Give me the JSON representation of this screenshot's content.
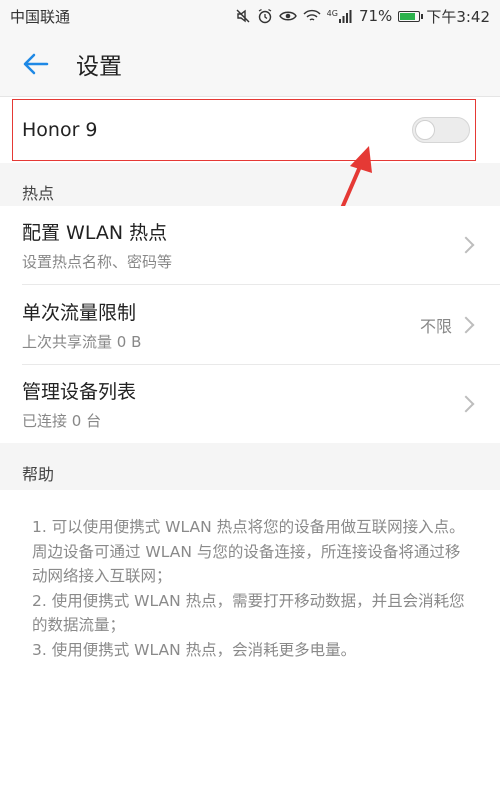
{
  "statusbar": {
    "carrier": "中国联通",
    "network": "4G",
    "battery_pct": "71%",
    "battery_level": 0.71,
    "time": "下午3:42"
  },
  "appbar": {
    "title": "设置"
  },
  "hotspot": {
    "name": "Honor 9",
    "enabled": false
  },
  "sections": {
    "hotspot_label": "热点",
    "help_label": "帮助"
  },
  "items": [
    {
      "title": "配置 WLAN 热点",
      "subtitle": "设置热点名称、密码等",
      "value": ""
    },
    {
      "title": "单次流量限制",
      "subtitle": "上次共享流量 0 B",
      "value": "不限"
    },
    {
      "title": "管理设备列表",
      "subtitle": "已连接 0 台",
      "value": ""
    }
  ],
  "help": {
    "text": "1. 可以使用便携式 WLAN 热点将您的设备用做互联网接入点。周边设备可通过 WLAN 与您的设备连接，所连接设备将通过移动网络接入互联网；\n2. 使用便携式 WLAN 热点，需要打开移动数据，并且会消耗您的数据流量；\n3. 使用便携式 WLAN 热点，会消耗更多电量。"
  },
  "colors": {
    "accent": "#1e88e5",
    "annotation_red": "#e53935",
    "battery_green": "#2bb24c"
  }
}
